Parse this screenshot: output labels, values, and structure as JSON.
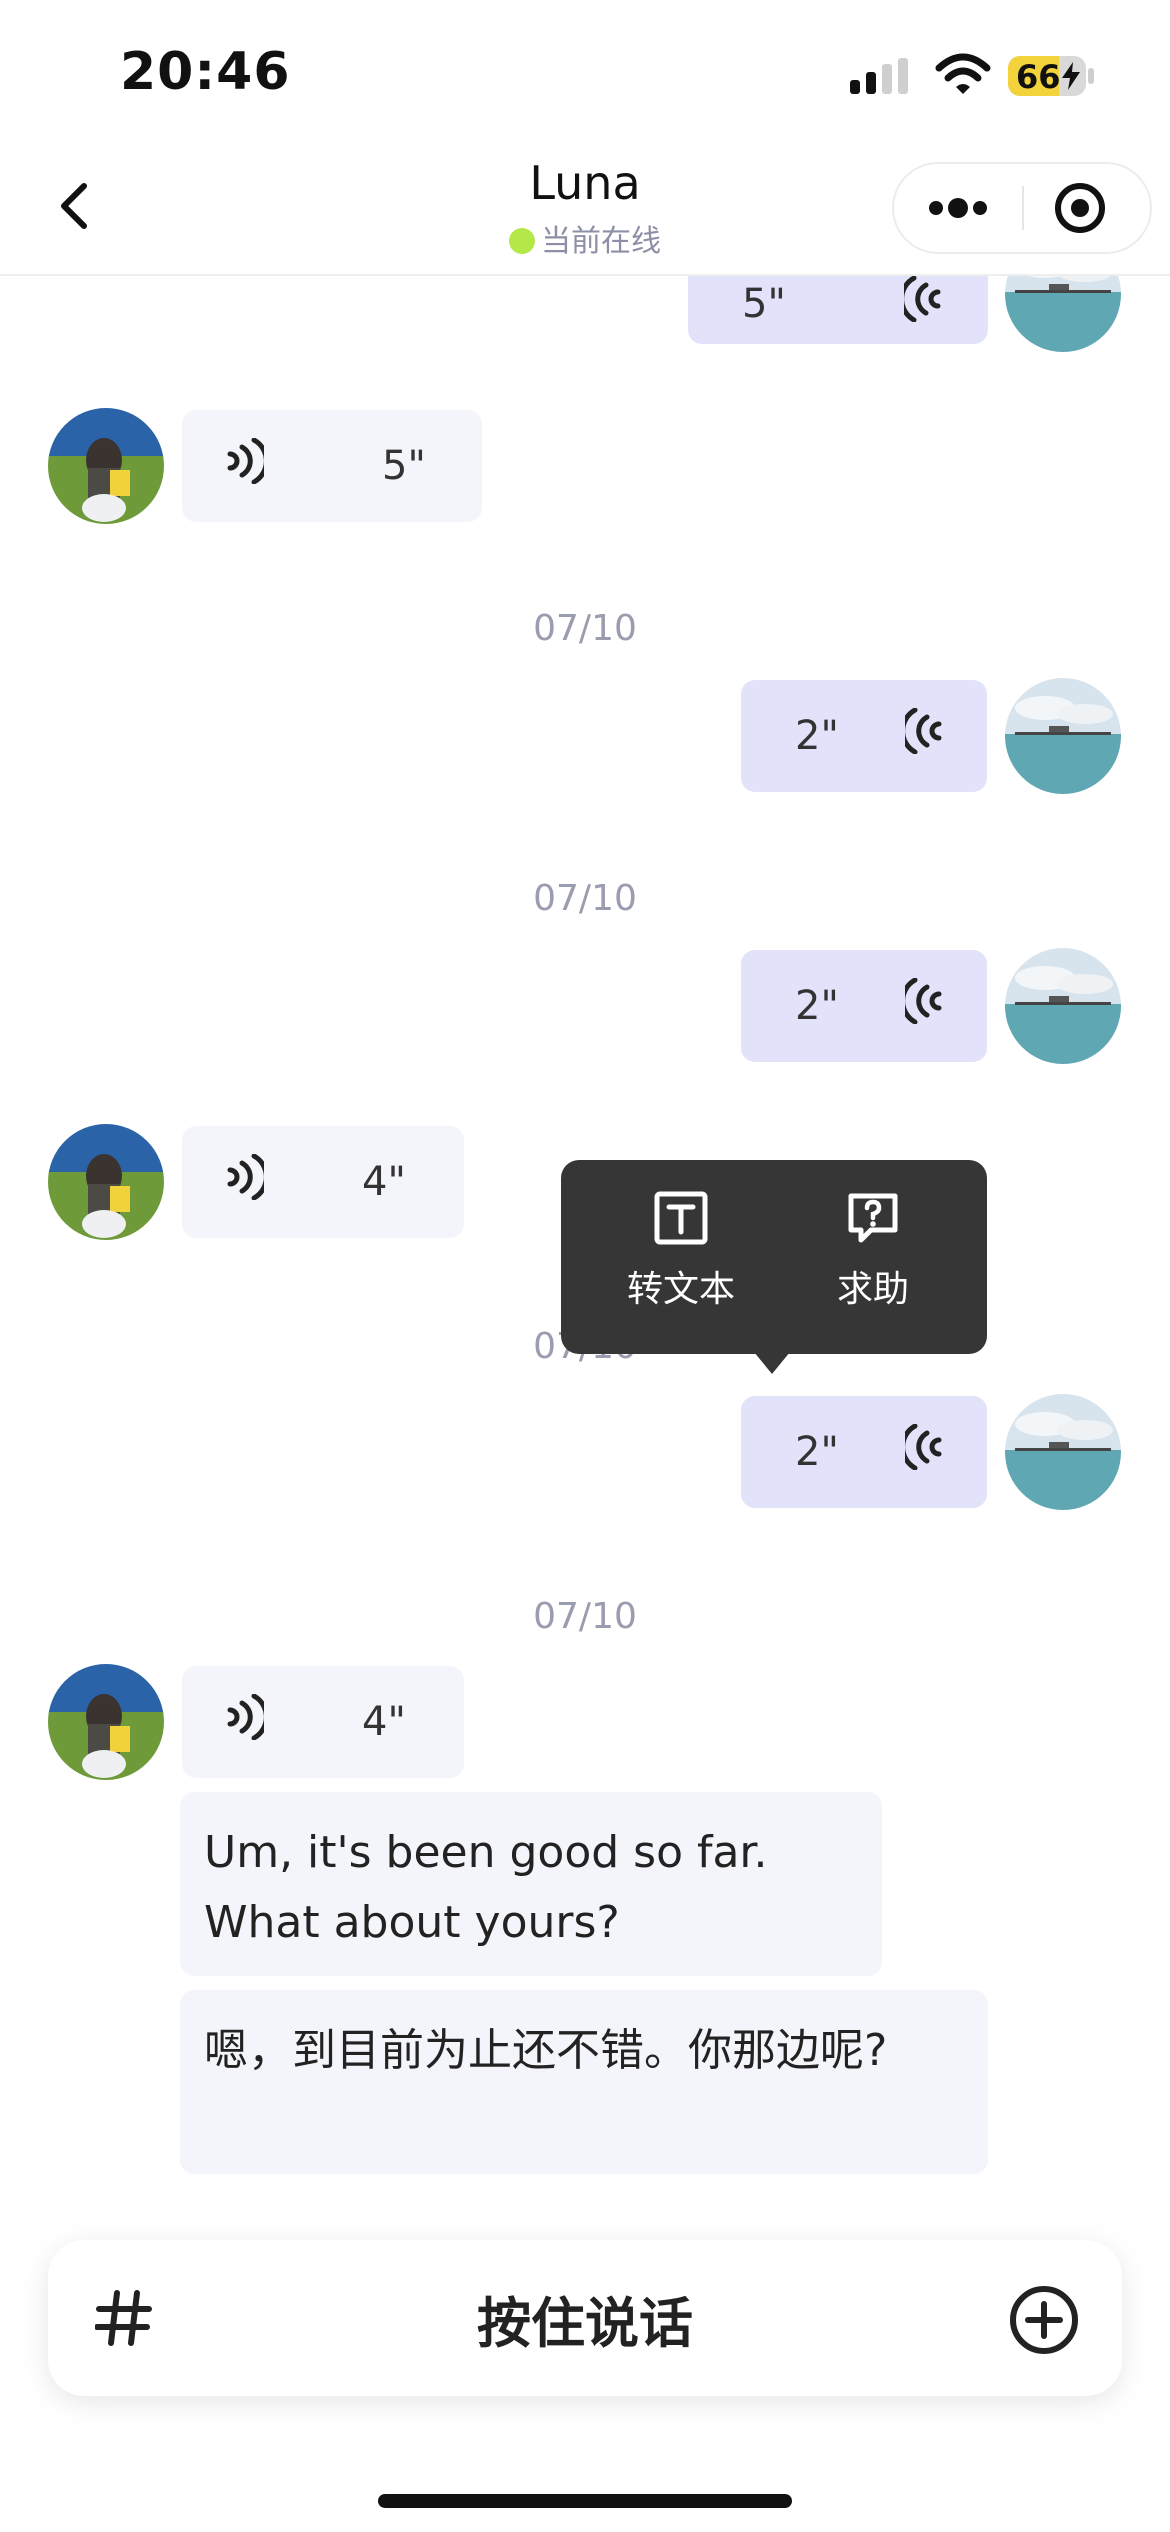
{
  "status_bar": {
    "time": "20:46",
    "battery": "66",
    "battery_level": 0.66
  },
  "nav": {
    "title": "Luna",
    "status": "当前在线"
  },
  "messages": [
    {
      "type": "voice",
      "side": "sent",
      "duration": "5\""
    },
    {
      "type": "voice",
      "side": "received",
      "duration": "5\""
    },
    {
      "type": "timestamp",
      "text": "07/10"
    },
    {
      "type": "voice",
      "side": "sent",
      "duration": "2\""
    },
    {
      "type": "timestamp",
      "text": "07/10"
    },
    {
      "type": "voice",
      "side": "sent",
      "duration": "2\""
    },
    {
      "type": "voice",
      "side": "received",
      "duration": "4\""
    },
    {
      "type": "timestamp",
      "text": "07/10"
    },
    {
      "type": "voice",
      "side": "sent",
      "duration": "2\""
    },
    {
      "type": "timestamp",
      "text": "07/10"
    },
    {
      "type": "voice",
      "side": "received",
      "duration": "4\""
    },
    {
      "type": "transcript",
      "text": "Um, it's been good so far. What about yours?"
    },
    {
      "type": "translation",
      "text": "嗯，到目前为止还不错。你那边呢?"
    }
  ],
  "popover": {
    "items": [
      {
        "label": "转文本",
        "icon": "text-icon"
      },
      {
        "label": "求助",
        "icon": "help-icon"
      }
    ]
  },
  "input_bar": {
    "hold_to_talk": "按住说话",
    "left_icon": "hash-icon",
    "right_icon": "plus-circle-icon"
  },
  "colors": {
    "sent_bubble": "#e2e2fb",
    "received_bubble": "#f4f5fb",
    "online_dot": "#b4e848",
    "popover_bg": "#363636"
  }
}
